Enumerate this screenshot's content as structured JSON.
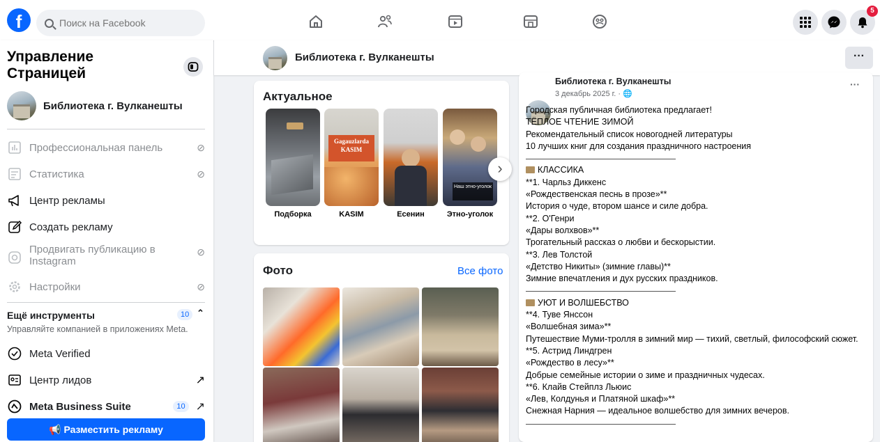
{
  "topbar": {
    "logo_letter": "f",
    "search_placeholder": "Поиск на Facebook",
    "nav_icons": [
      "home-icon",
      "friends-icon",
      "video-icon",
      "marketplace-icon",
      "groups-icon"
    ],
    "notifications_badge": "5",
    "accent_color": "#0866ff"
  },
  "sidebar": {
    "title": "Управление Страницей",
    "page_name": "Библиотека г. Вулканешты",
    "menu": [
      {
        "label": "Профессиональная панель",
        "disabled": true
      },
      {
        "label": "Статистика",
        "disabled": true
      },
      {
        "label": "Центр рекламы",
        "disabled": false
      },
      {
        "label": "Создать рекламу",
        "disabled": false
      },
      {
        "label": "Продвигать публикацию в Instagram",
        "disabled": true
      },
      {
        "label": "Настройки",
        "disabled": true
      }
    ],
    "tools_title": "Ещё инструменты",
    "tools_count": "10",
    "tools_subtitle": "Управляйте компанией в приложениях Meta.",
    "tools": [
      {
        "label": "Meta Verified",
        "count": ""
      },
      {
        "label": "Центр лидов",
        "count": ""
      },
      {
        "label": "Meta Business Suite",
        "count": "10"
      }
    ],
    "promote_button": "Разместить рекламу"
  },
  "page_header": {
    "name": "Библиотека г. Вулканешты",
    "more": "···"
  },
  "highlights": {
    "title": "Актуальное",
    "stories": [
      {
        "label": "Подборка"
      },
      {
        "label": "KASIM",
        "overlay": "Gagauzlarda KASIM"
      },
      {
        "label": "Есенин"
      },
      {
        "label": "Этно-уголок",
        "overlay": "Наш этно-уголок"
      }
    ]
  },
  "photos": {
    "title": "Фото",
    "all_link": "Все фото"
  },
  "post": {
    "author": "Библиотека г. Вулканешты",
    "date": "3 декабрь 2025 г. · ",
    "more": "···",
    "lines": [
      "Городская публичная библиотека предлагает!",
      "ТЁПЛОЕ ЧТЕНИЕ ЗИМОЙ",
      "Рекомендательный список новогодней литературы",
      "10 лучших книг для создания праздничного настроения",
      "",
      "КЛАССИКА",
      "**1. Чарльз Диккенс",
      "«Рождественская песнь в прозе»**",
      "История о чуде, втором шансе и силе добра.",
      "**2. О'Генри",
      "«Дары волхвов»**",
      "Трогательный рассказ о любви и бескорыстии.",
      "**3. Лев Толстой",
      "«Детство Никиты» (зимние главы)**",
      "Зимние впечатления и дух русских праздников.",
      "",
      "УЮТ И ВОЛШЕБСТВО",
      "**4. Туве Янссон",
      "«Волшебная зима»**",
      "Путешествие Муми-тролля в зимний мир — тихий, светлый, философский сюжет.",
      "**5. Астрид Линдгрен",
      "«Рождество в лесу»**",
      "Добрые семейные истории о зиме и праздничных чудесах.",
      "**6. Клайв Стейплз Льюис",
      "«Лев, Колдунья и Платяной шкаф»**",
      "Снежная Нарния — идеальное волшебство для зимних вечеров.",
      ""
    ]
  }
}
